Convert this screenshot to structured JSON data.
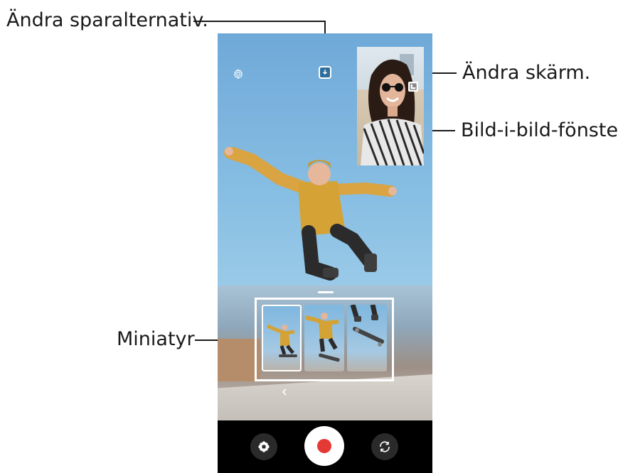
{
  "callouts": {
    "save_options": "Ändra sparalternativ.",
    "switch_screen": "Ändra skärm.",
    "pip_window": "Bild-i-bild-fönster",
    "thumbnail": "Miniatyr"
  },
  "icons": {
    "settings": "gear-icon",
    "save_option": "download-icon",
    "switch_screen": "switch-screen-icon",
    "effect": "flower-icon",
    "record": "record-button",
    "flip": "flip-camera-icon",
    "collapse": "chevron-left-icon"
  },
  "colors": {
    "record_red": "#e53935",
    "control_bar": "#000000",
    "sky": "#86bde3"
  },
  "thumbnails": [
    "thumbnail-1",
    "thumbnail-2",
    "thumbnail-3"
  ]
}
